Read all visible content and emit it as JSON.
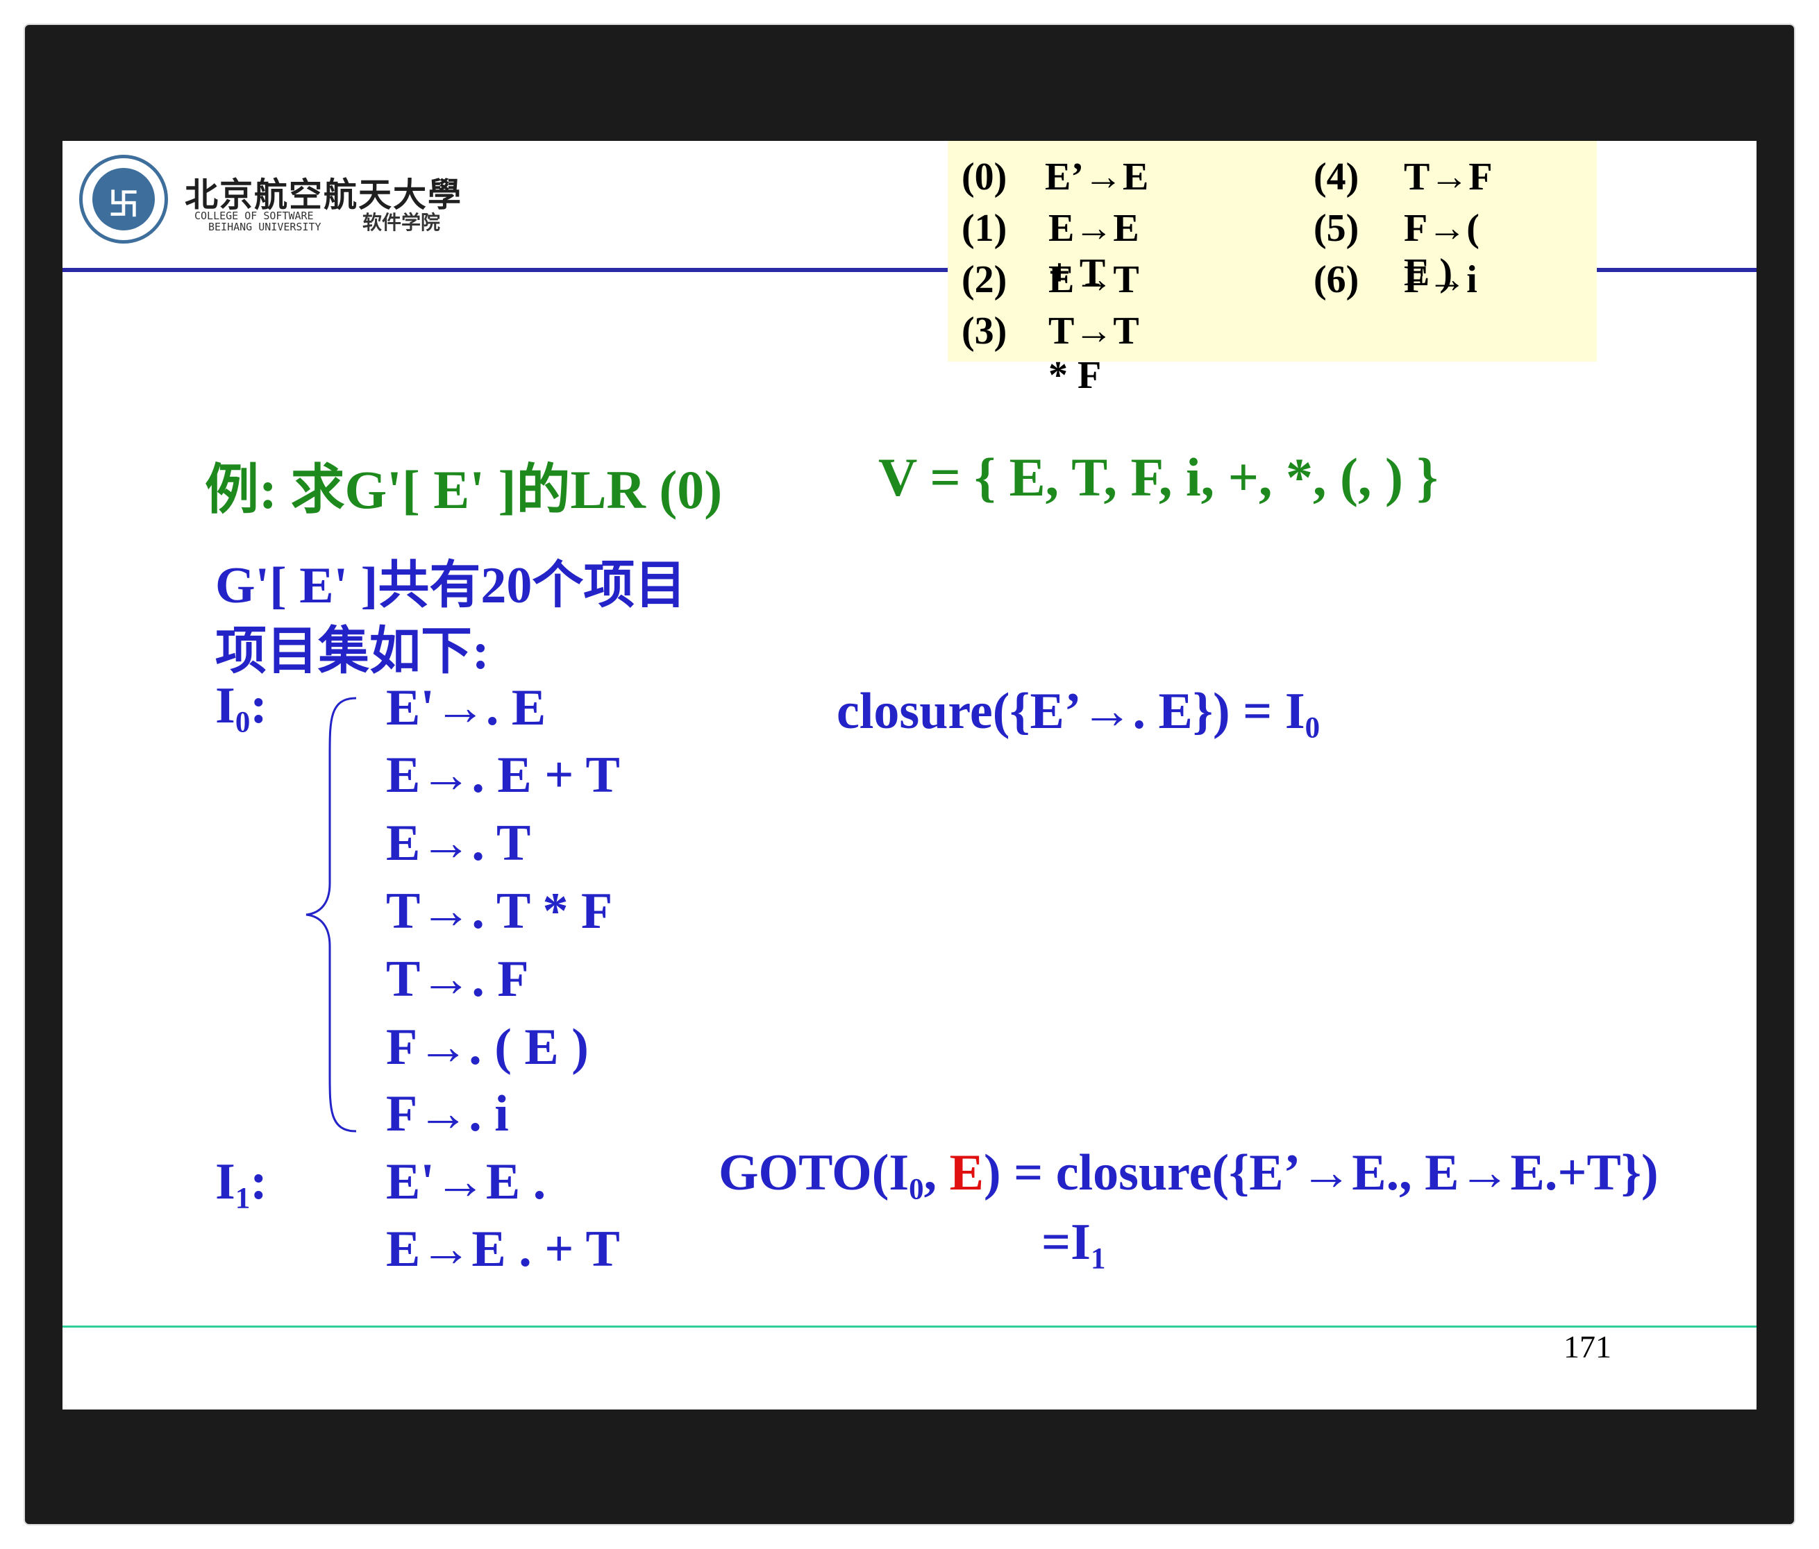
{
  "header": {
    "logo_alt": "beihang-emblem-icon",
    "university_name": "北京航空航天大學",
    "college_en_line1": "COLLEGE OF SOFTWARE",
    "college_en_line2": "BEIHANG UNIVERSITY",
    "college_cn": "软件学院"
  },
  "productions": [
    {
      "num": "(0)",
      "rule": "E’→E"
    },
    {
      "num": "(1)",
      "rule": "E→E + T"
    },
    {
      "num": "(2)",
      "rule": "E→T"
    },
    {
      "num": "(3)",
      "rule": "T→T * F"
    },
    {
      "num": "(4)",
      "rule": "T→F"
    },
    {
      "num": "(5)",
      "rule": "F→( E )"
    },
    {
      "num": "(6)",
      "rule": "F→i"
    }
  ],
  "example": {
    "title": "例:  求G'[ E' ]的LR (0)",
    "vocab": "V = { E,  T,   F,   i,   +,   *,  (,  ) }"
  },
  "intro": {
    "line1": "G'[ E' ]共有20个项目",
    "line2": "项目集如下:"
  },
  "I0": {
    "label": "I",
    "sub": "0",
    "colon": ":",
    "items": [
      "E'→. E",
      "E→. E + T",
      "E→. T",
      "T→. T * F",
      "T→. F",
      "F→. ( E )",
      "F→. i"
    ],
    "closure_text": "closure({E’→. E}) = I",
    "closure_sub": "0"
  },
  "I1": {
    "label": "I",
    "sub": "1",
    "colon": ":",
    "items": [
      "E'→E .",
      "E→E . + T"
    ],
    "goto_prefix": "GOTO(I",
    "goto_sub": "0",
    "goto_comma": ", ",
    "goto_symbol": "E",
    "goto_rest": ") = closure({E’→E., E→E.+T})",
    "result_text": "=I",
    "result_sub": "1"
  },
  "footer": {
    "page_number": "171"
  },
  "colors": {
    "title_green": "#1e8a1e",
    "text_blue": "#2323c8",
    "highlight_red": "#e01010",
    "box_yellow": "#fffdd6",
    "header_line": "#2a2aa6",
    "footer_line": "#2fcf9a"
  }
}
